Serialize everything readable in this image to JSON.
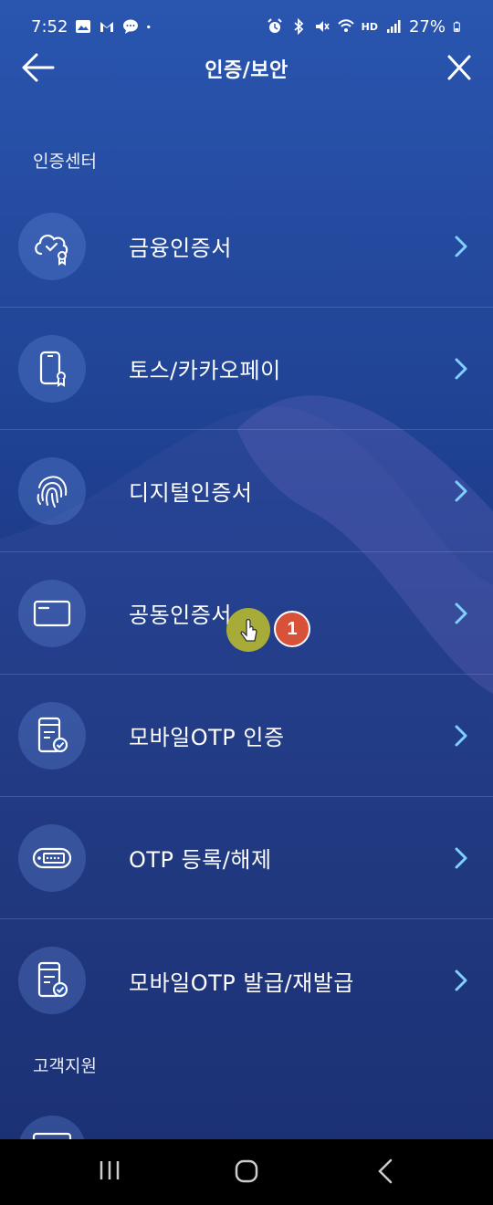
{
  "status_bar": {
    "time": "7:52",
    "battery": "27%",
    "hd_label": "HD",
    "icons": [
      "photo-icon",
      "gmail-icon",
      "chat-icon",
      "dot-icon",
      "alarm-icon",
      "bluetooth-icon",
      "mute-icon",
      "wifi-icon",
      "signal-icon",
      "battery-icon"
    ]
  },
  "header": {
    "title": "인증/보안",
    "back_icon": "back-arrow-icon",
    "close_icon": "close-icon"
  },
  "sections": {
    "auth_center": "인증센터",
    "customer_support": "고객지원"
  },
  "menu": [
    {
      "label": "금융인증서",
      "icon": "cloud-certificate-icon"
    },
    {
      "label": "토스/카카오페이",
      "icon": "phone-certificate-icon"
    },
    {
      "label": "디지털인증서",
      "icon": "fingerprint-icon"
    },
    {
      "label": "공동인증서",
      "icon": "card-icon"
    },
    {
      "label": "모바일OTP 인증",
      "icon": "mobile-otp-check-icon"
    },
    {
      "label": "OTP 등록/해제",
      "icon": "otp-token-icon"
    },
    {
      "label": "모바일OTP 발급/재발급",
      "icon": "mobile-otp-check-icon"
    }
  ],
  "overlay": {
    "step_badge": "1"
  },
  "colors": {
    "accent": "#7fd0ff",
    "badge": "#d8523a",
    "cursor": "#bebe28"
  }
}
